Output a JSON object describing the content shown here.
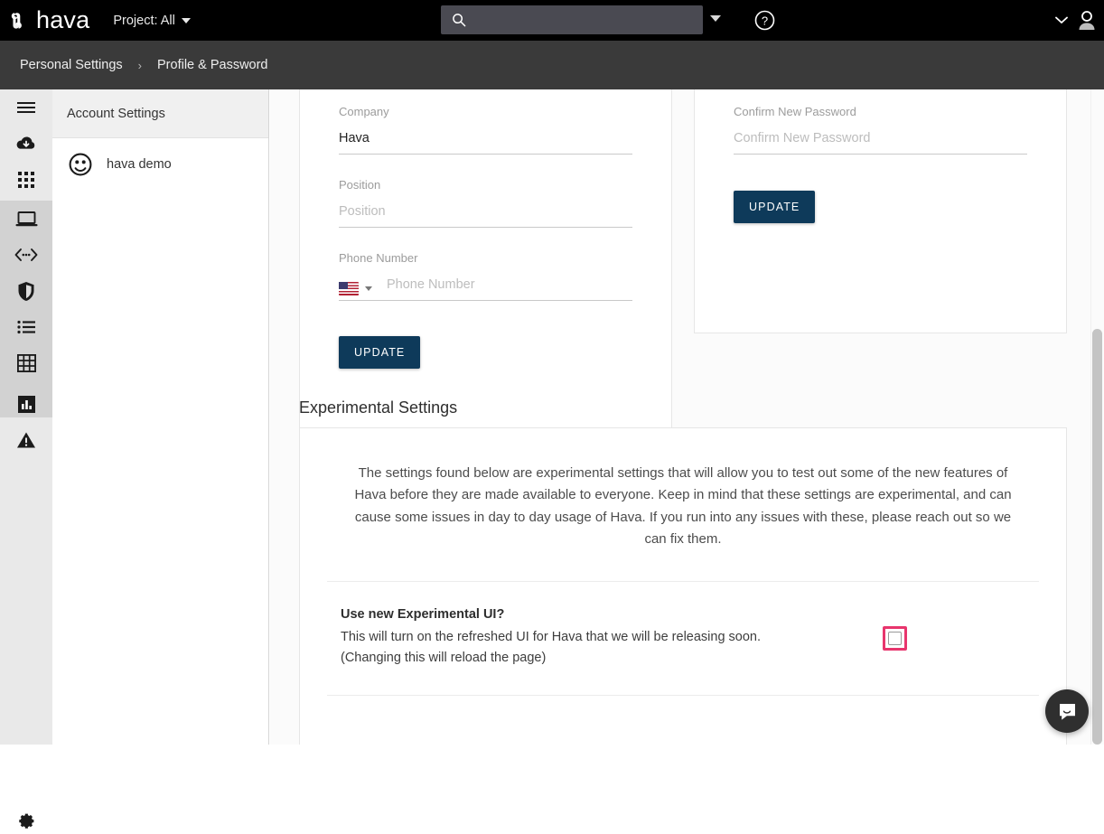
{
  "topbar": {
    "logo_text": "hava",
    "logo_mark_icon": "hava-logo-icon",
    "project_label": "Project: All",
    "project_caret_icon": "chevron-down-icon",
    "search_icon": "search-icon",
    "search_value": "",
    "search_placeholder": "",
    "search_caret_icon": "caret-down-icon",
    "help_icon": "question-circle-icon",
    "user_caret_icon": "chevron-down-icon",
    "avatar_icon": "user-avatar-icon"
  },
  "breadcrumb": {
    "parent": "Personal Settings",
    "separator": "›",
    "current": "Profile & Password"
  },
  "rail": {
    "items": [
      {
        "name": "hamburger-menu-icon",
        "label": "Menu"
      },
      {
        "name": "cloud-download-icon",
        "label": "Import"
      },
      {
        "name": "apps-grid-icon",
        "label": "Apps"
      },
      {
        "name": "laptop-icon",
        "label": "Environments"
      },
      {
        "name": "code-brackets-icon",
        "label": "Connections"
      },
      {
        "name": "shield-icon",
        "label": "Security"
      },
      {
        "name": "list-icon",
        "label": "Lists"
      },
      {
        "name": "table-grid-icon",
        "label": "Tables"
      },
      {
        "name": "bar-chart-icon",
        "label": "Reports"
      },
      {
        "name": "warning-triangle-icon",
        "label": "Alerts"
      }
    ],
    "settings_icon": "gear-icon"
  },
  "account_panel": {
    "title": "Account Settings",
    "user_avatar_icon": "user-face-icon",
    "user_name": "hava demo"
  },
  "profile_form": {
    "company_label": "Company",
    "company_value": "Hava",
    "position_label": "Position",
    "position_value": "",
    "position_placeholder": "Position",
    "phone_label": "Phone Number",
    "phone_value": "",
    "phone_placeholder": "Phone Number",
    "phone_country_flag": "us-flag-icon",
    "phone_country_caret": "caret-down-icon",
    "update_label": "UPDATE"
  },
  "password_form": {
    "confirm_label": "Confirm New Password",
    "confirm_value": "",
    "confirm_placeholder": "Confirm New Password",
    "update_label": "UPDATE"
  },
  "experimental": {
    "section_title": "Experimental Settings",
    "blurb": "The settings found below are experimental settings that will allow you to test out some of the new features of Hava before they are made available to everyone. Keep in mind that these settings are experimental, and can cause some issues in day to day usage of Hava. If you run into any issues with these, please reach out so we can fix them.",
    "toggle_title": "Use new Experimental UI?",
    "toggle_desc_line1": "This will turn on the refreshed UI for Hava that we will be releasing soon.",
    "toggle_desc_line2": "(Changing this will reload the page)",
    "toggle_checked": false,
    "highlight_color": "#e8356d"
  },
  "chat": {
    "icon": "chat-bubble-icon"
  },
  "colors": {
    "topbar_bg": "#000000",
    "crumbbar_bg": "#3a3a3a",
    "button_navy": "#0e3a5a",
    "rail_bg": "#e9e9e9",
    "rail_active_bg": "#d2d2d2",
    "page_bg": "#fbfbfb",
    "highlight_pink": "#e8356d"
  }
}
